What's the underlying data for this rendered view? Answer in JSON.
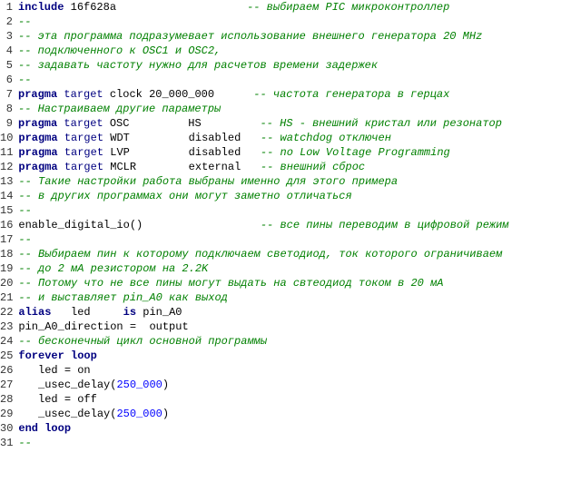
{
  "lines": [
    {
      "num": 1,
      "html": "<span class='kw'>include</span> <span class='plain'>16f628a</span>                    <span class='comment'>-- выбираем PIC микроконтроллер</span>"
    },
    {
      "num": 2,
      "html": "<span class='comment'>--</span>"
    },
    {
      "num": 3,
      "html": "<span class='comment'>-- эта программа подразумевает использование внешнего генератора 20 MHz</span>"
    },
    {
      "num": 4,
      "html": "<span class='comment'>-- подключенного к OSC1 и OSC2,</span>"
    },
    {
      "num": 5,
      "html": "<span class='comment'>-- задавать частоту нужно для расчетов времени задержек</span>"
    },
    {
      "num": 6,
      "html": "<span class='comment'>--</span>"
    },
    {
      "num": 7,
      "html": "<span class='kw'>pragma</span> <span class='target-kw'>target</span> <span class='plain'>clock</span> <span class='plain'>20_000_000</span>      <span class='comment'>-- частота генератора в герцах</span>"
    },
    {
      "num": 8,
      "html": "<span class='comment'>-- Настраиваем другие параметры</span>"
    },
    {
      "num": 9,
      "html": "<span class='kw'>pragma</span> <span class='target-kw'>target</span> <span class='plain'>OSC</span>         <span class='plain'>HS</span>         <span class='comment'>-- HS - внешний кристал или резонатор</span>"
    },
    {
      "num": 10,
      "html": "<span class='kw'>pragma</span> <span class='target-kw'>target</span> <span class='plain'>WDT</span>         <span class='plain'>disabled</span>   <span class='comment'>-- watchdog отключен</span>"
    },
    {
      "num": 11,
      "html": "<span class='kw'>pragma</span> <span class='target-kw'>target</span> <span class='plain'>LVP</span>         <span class='plain'>disabled</span>   <span class='comment'>-- no Low Voltage Programming</span>"
    },
    {
      "num": 12,
      "html": "<span class='kw'>pragma</span> <span class='target-kw'>target</span> <span class='plain'>MCLR</span>        <span class='plain'>external</span>   <span class='comment'>-- внешний сброс</span>"
    },
    {
      "num": 13,
      "html": "<span class='comment'>-- Такие настройки работа выбраны именно для этого примера</span>"
    },
    {
      "num": 14,
      "html": "<span class='comment'>-- в других программах они могут заметно отличаться</span>"
    },
    {
      "num": 15,
      "html": "<span class='comment'>--</span>"
    },
    {
      "num": 16,
      "html": "<span class='func'>enable_digital_io</span><span class='plain'>()</span>                  <span class='comment'>-- все пины переводим в цифровой режим</span>"
    },
    {
      "num": 17,
      "html": "<span class='comment'>--</span>"
    },
    {
      "num": 18,
      "html": "<span class='comment'>-- Выбираем пин к которому подключаем светодиод, ток которого ограничиваем</span>"
    },
    {
      "num": 19,
      "html": "<span class='comment'>-- до 2 мА резистором на 2.2K</span>"
    },
    {
      "num": 20,
      "html": "<span class='comment'>-- Потому что не все пины могут выдать на свтеодиод током в 20 мА</span>"
    },
    {
      "num": 21,
      "html": "<span class='comment'>-- и выставляет pin_A0 как выход</span>"
    },
    {
      "num": 22,
      "html": "<span class='kw'>alias</span>   <span class='plain'>led</span>     <span class='kw'>is</span> <span class='plain'>pin_A0</span>"
    },
    {
      "num": 23,
      "html": "<span class='plain'>pin_A0_direction</span> <span class='plain'>=</span>  <span class='plain'>output</span>"
    },
    {
      "num": 24,
      "html": "<span class='comment'>-- бесконечный цикл основной программы</span>"
    },
    {
      "num": 25,
      "html": "<span class='kw'>forever</span> <span class='kw'>loop</span>"
    },
    {
      "num": 26,
      "html": "   <span class='plain'>led</span> <span class='plain'>=</span> <span class='plain'>on</span>"
    },
    {
      "num": 27,
      "html": "   <span class='func'>_usec_delay</span><span class='plain'>(</span><span class='number'>250_000</span><span class='plain'>)</span>"
    },
    {
      "num": 28,
      "html": "   <span class='plain'>led</span> <span class='plain'>=</span> <span class='plain'>off</span>"
    },
    {
      "num": 29,
      "html": "   <span class='func'>_usec_delay</span><span class='plain'>(</span><span class='number'>250_000</span><span class='plain'>)</span>"
    },
    {
      "num": 30,
      "html": "<span class='kw'>end</span> <span class='kw'>loop</span>"
    },
    {
      "num": 31,
      "html": "<span class='comment'>--</span>"
    }
  ]
}
